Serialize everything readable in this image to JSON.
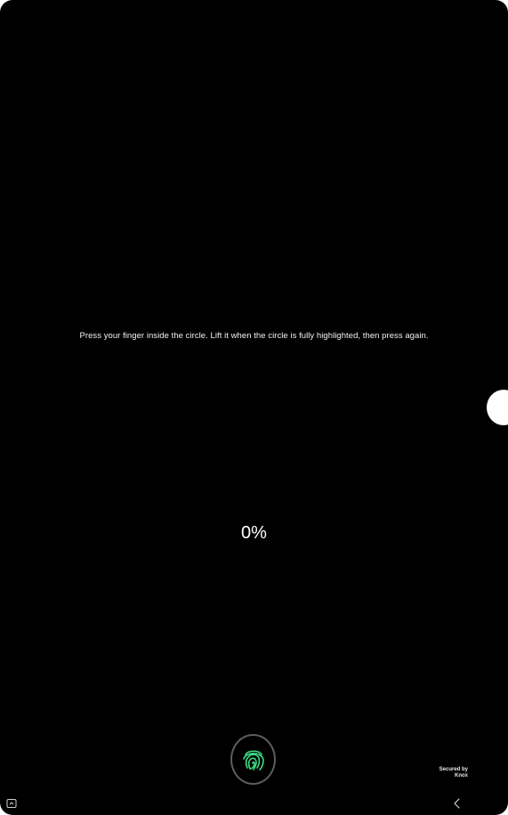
{
  "instruction_text": "Press your finger inside the circle. Lift it when the circle is fully highlighted, then press again.",
  "progress_text": "0%",
  "fingerprint_button": {
    "icon": "fingerprint-icon",
    "accent_color": "#3ddc84"
  },
  "knox": {
    "line1": "Secured by",
    "line2": "Knox"
  },
  "nav": {
    "left_icon": "screenshot-icon",
    "back_icon": "back-icon"
  }
}
